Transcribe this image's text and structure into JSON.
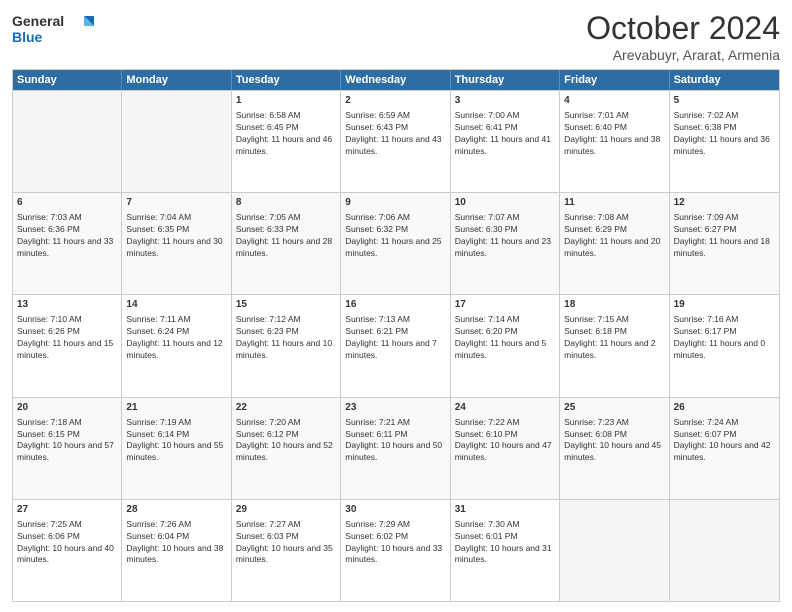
{
  "logo": {
    "line1": "General",
    "line2": "Blue"
  },
  "title": "October 2024",
  "subtitle": "Arevabuyr, Ararat, Armenia",
  "weekdays": [
    "Sunday",
    "Monday",
    "Tuesday",
    "Wednesday",
    "Thursday",
    "Friday",
    "Saturday"
  ],
  "weeks": [
    [
      {
        "day": "",
        "sunrise": "",
        "sunset": "",
        "daylight": "",
        "empty": true
      },
      {
        "day": "",
        "sunrise": "",
        "sunset": "",
        "daylight": "",
        "empty": true
      },
      {
        "day": "1",
        "sunrise": "Sunrise: 6:58 AM",
        "sunset": "Sunset: 6:45 PM",
        "daylight": "Daylight: 11 hours and 46 minutes."
      },
      {
        "day": "2",
        "sunrise": "Sunrise: 6:59 AM",
        "sunset": "Sunset: 6:43 PM",
        "daylight": "Daylight: 11 hours and 43 minutes."
      },
      {
        "day": "3",
        "sunrise": "Sunrise: 7:00 AM",
        "sunset": "Sunset: 6:41 PM",
        "daylight": "Daylight: 11 hours and 41 minutes."
      },
      {
        "day": "4",
        "sunrise": "Sunrise: 7:01 AM",
        "sunset": "Sunset: 6:40 PM",
        "daylight": "Daylight: 11 hours and 38 minutes."
      },
      {
        "day": "5",
        "sunrise": "Sunrise: 7:02 AM",
        "sunset": "Sunset: 6:38 PM",
        "daylight": "Daylight: 11 hours and 36 minutes."
      }
    ],
    [
      {
        "day": "6",
        "sunrise": "Sunrise: 7:03 AM",
        "sunset": "Sunset: 6:36 PM",
        "daylight": "Daylight: 11 hours and 33 minutes."
      },
      {
        "day": "7",
        "sunrise": "Sunrise: 7:04 AM",
        "sunset": "Sunset: 6:35 PM",
        "daylight": "Daylight: 11 hours and 30 minutes."
      },
      {
        "day": "8",
        "sunrise": "Sunrise: 7:05 AM",
        "sunset": "Sunset: 6:33 PM",
        "daylight": "Daylight: 11 hours and 28 minutes."
      },
      {
        "day": "9",
        "sunrise": "Sunrise: 7:06 AM",
        "sunset": "Sunset: 6:32 PM",
        "daylight": "Daylight: 11 hours and 25 minutes."
      },
      {
        "day": "10",
        "sunrise": "Sunrise: 7:07 AM",
        "sunset": "Sunset: 6:30 PM",
        "daylight": "Daylight: 11 hours and 23 minutes."
      },
      {
        "day": "11",
        "sunrise": "Sunrise: 7:08 AM",
        "sunset": "Sunset: 6:29 PM",
        "daylight": "Daylight: 11 hours and 20 minutes."
      },
      {
        "day": "12",
        "sunrise": "Sunrise: 7:09 AM",
        "sunset": "Sunset: 6:27 PM",
        "daylight": "Daylight: 11 hours and 18 minutes."
      }
    ],
    [
      {
        "day": "13",
        "sunrise": "Sunrise: 7:10 AM",
        "sunset": "Sunset: 6:26 PM",
        "daylight": "Daylight: 11 hours and 15 minutes."
      },
      {
        "day": "14",
        "sunrise": "Sunrise: 7:11 AM",
        "sunset": "Sunset: 6:24 PM",
        "daylight": "Daylight: 11 hours and 12 minutes."
      },
      {
        "day": "15",
        "sunrise": "Sunrise: 7:12 AM",
        "sunset": "Sunset: 6:23 PM",
        "daylight": "Daylight: 11 hours and 10 minutes."
      },
      {
        "day": "16",
        "sunrise": "Sunrise: 7:13 AM",
        "sunset": "Sunset: 6:21 PM",
        "daylight": "Daylight: 11 hours and 7 minutes."
      },
      {
        "day": "17",
        "sunrise": "Sunrise: 7:14 AM",
        "sunset": "Sunset: 6:20 PM",
        "daylight": "Daylight: 11 hours and 5 minutes."
      },
      {
        "day": "18",
        "sunrise": "Sunrise: 7:15 AM",
        "sunset": "Sunset: 6:18 PM",
        "daylight": "Daylight: 11 hours and 2 minutes."
      },
      {
        "day": "19",
        "sunrise": "Sunrise: 7:16 AM",
        "sunset": "Sunset: 6:17 PM",
        "daylight": "Daylight: 11 hours and 0 minutes."
      }
    ],
    [
      {
        "day": "20",
        "sunrise": "Sunrise: 7:18 AM",
        "sunset": "Sunset: 6:15 PM",
        "daylight": "Daylight: 10 hours and 57 minutes."
      },
      {
        "day": "21",
        "sunrise": "Sunrise: 7:19 AM",
        "sunset": "Sunset: 6:14 PM",
        "daylight": "Daylight: 10 hours and 55 minutes."
      },
      {
        "day": "22",
        "sunrise": "Sunrise: 7:20 AM",
        "sunset": "Sunset: 6:12 PM",
        "daylight": "Daylight: 10 hours and 52 minutes."
      },
      {
        "day": "23",
        "sunrise": "Sunrise: 7:21 AM",
        "sunset": "Sunset: 6:11 PM",
        "daylight": "Daylight: 10 hours and 50 minutes."
      },
      {
        "day": "24",
        "sunrise": "Sunrise: 7:22 AM",
        "sunset": "Sunset: 6:10 PM",
        "daylight": "Daylight: 10 hours and 47 minutes."
      },
      {
        "day": "25",
        "sunrise": "Sunrise: 7:23 AM",
        "sunset": "Sunset: 6:08 PM",
        "daylight": "Daylight: 10 hours and 45 minutes."
      },
      {
        "day": "26",
        "sunrise": "Sunrise: 7:24 AM",
        "sunset": "Sunset: 6:07 PM",
        "daylight": "Daylight: 10 hours and 42 minutes."
      }
    ],
    [
      {
        "day": "27",
        "sunrise": "Sunrise: 7:25 AM",
        "sunset": "Sunset: 6:06 PM",
        "daylight": "Daylight: 10 hours and 40 minutes."
      },
      {
        "day": "28",
        "sunrise": "Sunrise: 7:26 AM",
        "sunset": "Sunset: 6:04 PM",
        "daylight": "Daylight: 10 hours and 38 minutes."
      },
      {
        "day": "29",
        "sunrise": "Sunrise: 7:27 AM",
        "sunset": "Sunset: 6:03 PM",
        "daylight": "Daylight: 10 hours and 35 minutes."
      },
      {
        "day": "30",
        "sunrise": "Sunrise: 7:29 AM",
        "sunset": "Sunset: 6:02 PM",
        "daylight": "Daylight: 10 hours and 33 minutes."
      },
      {
        "day": "31",
        "sunrise": "Sunrise: 7:30 AM",
        "sunset": "Sunset: 6:01 PM",
        "daylight": "Daylight: 10 hours and 31 minutes."
      },
      {
        "day": "",
        "sunrise": "",
        "sunset": "",
        "daylight": "",
        "empty": true
      },
      {
        "day": "",
        "sunrise": "",
        "sunset": "",
        "daylight": "",
        "empty": true
      }
    ]
  ]
}
